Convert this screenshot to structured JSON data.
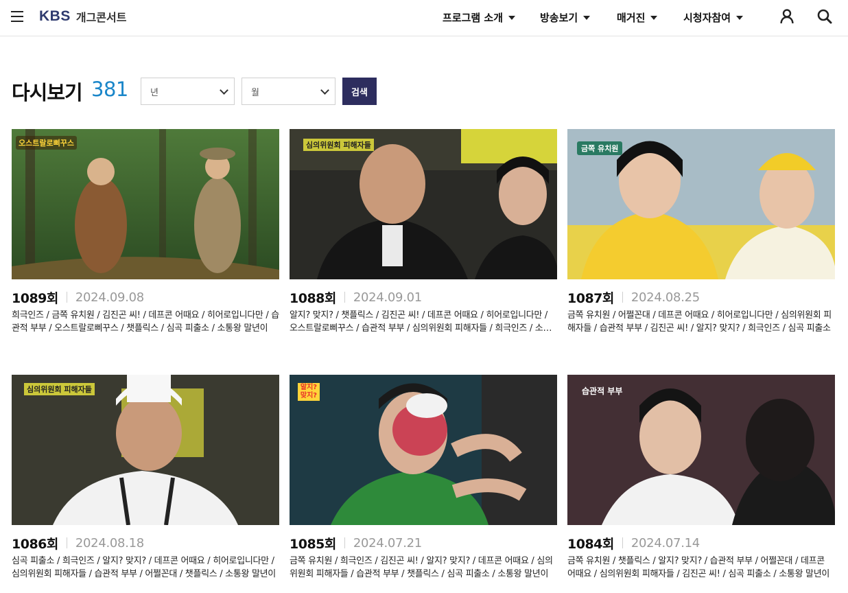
{
  "header": {
    "logo": "KBS",
    "program_name": "개그콘서트",
    "nav": [
      {
        "label": "프로그램 소개"
      },
      {
        "label": "방송보기"
      },
      {
        "label": "매거진"
      },
      {
        "label": "시청자참여"
      }
    ]
  },
  "page": {
    "title": "다시보기",
    "count": "381",
    "year_select": "년",
    "month_select": "월",
    "search_label": "검색"
  },
  "episodes": [
    {
      "episode": "1089회",
      "date": "2024.09.08",
      "badge": "오스트랄로삐꾸스",
      "description": "희극인즈 / 금쪽 유치원 / 김진곤 씨! / 데프콘 어때요 / 히어로입니다만 / 습관적 부부 / 오스트랄로삐꾸스 / 챗플릭스 / 심곡 피출소 / 소통왕 말년이"
    },
    {
      "episode": "1088회",
      "date": "2024.09.01",
      "badge": "심의위원회 피해자들",
      "description": "알지? 맞지? / 챗플릭스 / 김진곤 씨! / 데프콘 어때요 / 히어로입니다만 / 오스트랄로삐꾸스 / 습관적 부부 / 심의위원회 피해자들 / 희극인즈 / 소통왕 말년이"
    },
    {
      "episode": "1087회",
      "date": "2024.08.25",
      "badge": "금쪽 유치원",
      "description": "금쪽 유치원 / 어쩔꼰대 / 데프콘 어때요 / 히어로입니다만 / 심의위원회 피해자들 / 습관적 부부 / 김진곤 씨! / 알지? 맞지? / 희극인즈 / 심곡 피출소"
    },
    {
      "episode": "1086회",
      "date": "2024.08.18",
      "badge": "심의위원회 피해자들",
      "description": "심곡 피출소 / 희극인즈 / 알지? 맞지? / 데프콘 어때요 / 히어로입니다만 / 심의위원회 피해자들 / 습관적 부부 / 어쩔꼰대 / 챗플릭스 / 소통왕 말년이"
    },
    {
      "episode": "1085회",
      "date": "2024.07.21",
      "badge": "알지? 맞지?",
      "description": "금쪽 유치원 / 희극인즈 / 김진곤 씨! / 알지? 맞지? / 데프콘 어때요 / 심의위원회 피해자들 / 습관적 부부 / 챗플릭스 / 심곡 피출소 / 소통왕 말년이"
    },
    {
      "episode": "1084회",
      "date": "2024.07.14",
      "badge": "습관적 부부",
      "description": "금쪽 유치원 / 챗플릭스 / 알지? 맞지? / 습관적 부부 / 어쩔꼰대 / 데프콘 어때요 / 심의위원회 피해자들 / 김진곤 씨! / 심곡 피출소 / 소통왕 말년이"
    }
  ]
}
